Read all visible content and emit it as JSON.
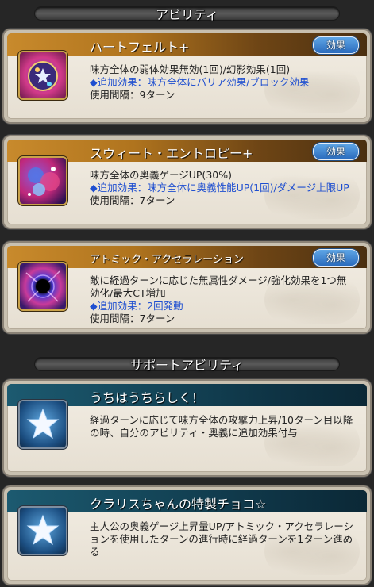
{
  "sections": {
    "abilities_title": "アビリティ",
    "support_title": "サポートアビリティ"
  },
  "effect_label": "効果",
  "abilities": [
    {
      "name": "ハートフェルト+",
      "desc": "味方全体の弱体効果無効(1回)/幻影効果(1回)",
      "extra": "◆追加効果：味方全体にバリア効果/ブロック効果",
      "cooldown": "使用間隔：9ターン"
    },
    {
      "name": "スウィート・エントロピー+",
      "desc": "味方全体の奥義ゲージUP(30%)",
      "extra": "◆追加効果：味方全体に奥義性能UP(1回)/ダメージ上限UP",
      "cooldown": "使用間隔：7ターン"
    },
    {
      "name": "アトミック・アクセラレーション",
      "desc": "敵に経過ターンに応じた無属性ダメージ/強化効果を1つ無効化/最大CT増加",
      "extra": "◆追加効果：2回発動",
      "cooldown": "使用間隔：7ターン"
    }
  ],
  "supports": [
    {
      "name": "うちはうちらしく！",
      "desc": "経過ターンに応じて味方全体の攻撃力上昇/10ターン目以降の時、自分のアビリティ・奥義に追加効果付与"
    },
    {
      "name": "クラリスちゃんの特製チョコ☆",
      "desc": "主人公の奥義ゲージ上昇量UP/アトミック・アクセラレーションを使用したターンの進行時に経過ターンを1ターン進める"
    }
  ],
  "icons": [
    "heart-gift-icon",
    "entropy-orbs-icon",
    "black-hole-icon",
    "star-icon",
    "star-icon"
  ]
}
